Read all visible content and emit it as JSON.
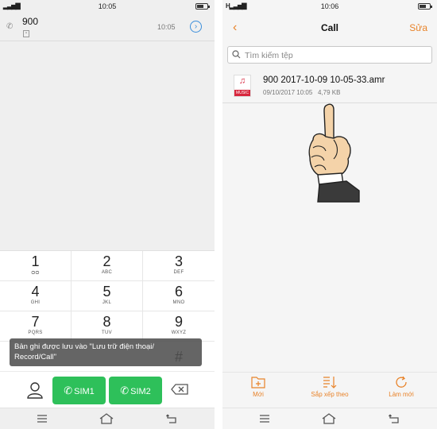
{
  "left_phone": {
    "status": {
      "time": "10:05"
    },
    "call_log": {
      "number": "900",
      "time": "10:05"
    },
    "keypad": [
      {
        "digit": "1",
        "letters": ""
      },
      {
        "digit": "2",
        "letters": "ABC"
      },
      {
        "digit": "3",
        "letters": "DEF"
      },
      {
        "digit": "4",
        "letters": "GHI"
      },
      {
        "digit": "5",
        "letters": "JKL"
      },
      {
        "digit": "6",
        "letters": "MNO"
      },
      {
        "digit": "7",
        "letters": "PQRS"
      },
      {
        "digit": "8",
        "letters": "TUV"
      },
      {
        "digit": "9",
        "letters": "WXYZ"
      },
      {
        "digit": "#",
        "letters": ""
      }
    ],
    "toast": "Bản ghi được lưu vào \"Lưu trữ điện thoại/ Record/Call\"",
    "sim1_label": "SIM1",
    "sim2_label": "SIM2"
  },
  "right_phone": {
    "status": {
      "time": "10:06"
    },
    "header": {
      "title": "Call",
      "edit_label": "Sửa"
    },
    "search": {
      "placeholder": "Tìm kiếm tệp"
    },
    "files": [
      {
        "name": "900 2017-10-09 10-05-33.amr",
        "date": "09/10/2017 10:05",
        "size": "4,79 KB",
        "icon_label": "MUSIC"
      }
    ],
    "toolbar": [
      {
        "label": "Mới",
        "icon": "new-folder-icon"
      },
      {
        "label": "Sắp xếp theo",
        "icon": "sort-icon"
      },
      {
        "label": "Làm mới",
        "icon": "refresh-icon"
      }
    ]
  },
  "colors": {
    "accent": "#e8832a",
    "call_green": "#2ec05a",
    "music_red": "#d7263d",
    "info_blue": "#3b8edb"
  }
}
